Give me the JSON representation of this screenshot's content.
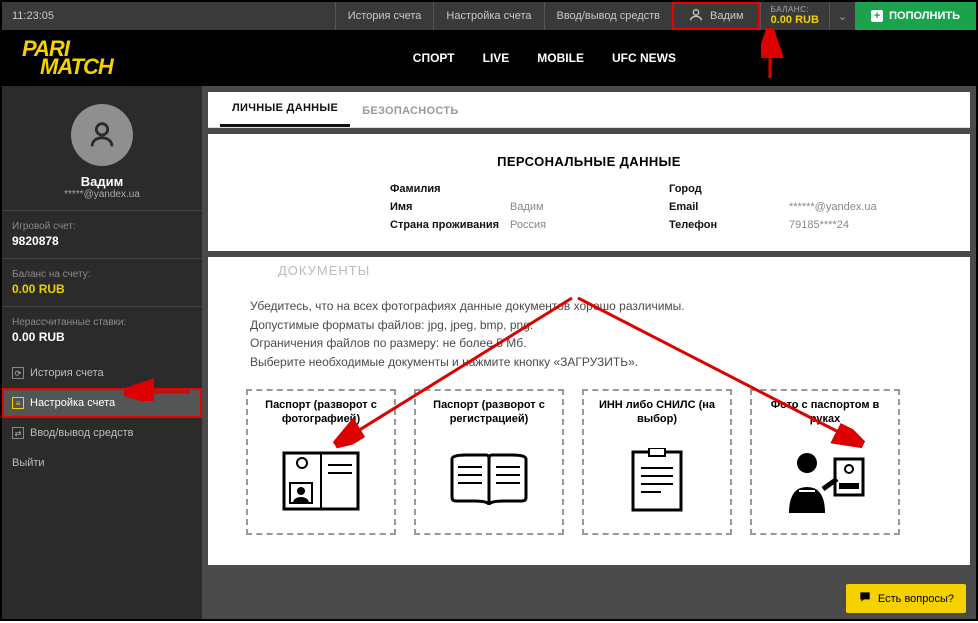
{
  "topbar": {
    "time": "11:23:05",
    "links": {
      "history": "История счета",
      "settings": "Настройка счета",
      "funds": "Ввод/вывод средств"
    },
    "user_name": "Вадим",
    "balance_label": "БАЛАНС:",
    "balance_value": "0.00 RUB",
    "replenish": "ПОПОЛНИТЬ"
  },
  "nav": {
    "sport": "СПОРТ",
    "live": "LIVE",
    "mobile": "MOBILE",
    "ufc": "UFC NEWS"
  },
  "logo": {
    "l1": "PARI",
    "l2": "MATCH"
  },
  "sidebar": {
    "user_name": "Вадим",
    "user_mail": "*****@yandex.ua",
    "game_acc_label": "Игровой счет:",
    "game_acc_value": "9820878",
    "balance_label": "Баланс на счету:",
    "balance_value": "0.00 RUB",
    "unsettled_label": "Нерассчитанные ставки:",
    "unsettled_value": "0.00 RUB",
    "menu": {
      "history": "История счета",
      "settings": "Настройка счета",
      "funds": "Ввод/вывод средств",
      "logout": "Выйти"
    }
  },
  "tabs": {
    "personal": "ЛИЧНЫЕ ДАННЫЕ",
    "security": "БЕЗОПАСНОСТЬ"
  },
  "personal": {
    "title": "ПЕРСОНАЛЬНЫЕ ДАННЫЕ",
    "surname_label": "Фамилия",
    "surname_value": "",
    "name_label": "Имя",
    "name_value": "Вадим",
    "country_label": "Страна проживания",
    "country_value": "Россия",
    "city_label": "Город",
    "city_value": "",
    "email_label": "Email",
    "email_value": "******@yandex.ua",
    "phone_label": "Телефон",
    "phone_value": "79185****24"
  },
  "documents": {
    "title": "ДОКУМЕНТЫ",
    "line1": "Убедитесь, что на всех фотографиях данные документов хорошо различимы.",
    "line2": "Допустимые форматы файлов: jpg, jpeg, bmp, png.",
    "line3": "Ограничения файлов по размеру: не более 5 Мб.",
    "line4": "Выберите необходимые документы и нажмите кнопку «ЗАГРУЗИТЬ».",
    "cards": {
      "passport_photo": "Паспорт (разворот с фотографией)",
      "passport_reg": "Паспорт (разворот с регистрацией)",
      "inn_snils": "ИНН либо СНИЛС (на выбор)",
      "selfie": "Фото с паспортом в руках"
    }
  },
  "questions": "Есть вопросы?"
}
